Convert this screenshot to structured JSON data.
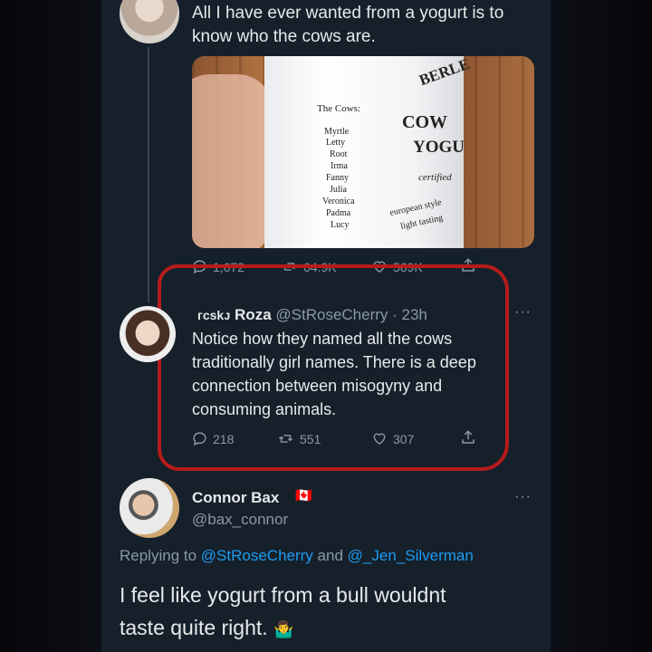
{
  "tweet1": {
    "text_line1": "All I have ever wanted from a yogurt is to",
    "text_line2": "know who the cows are.",
    "photo": {
      "brand_partial": "BERLE",
      "heading": "The Cows:",
      "names": [
        "Myrtle",
        "Letty",
        "Root",
        "Irma",
        "Fanny",
        "Julia",
        "Veronica",
        "Padma",
        "Lucy"
      ],
      "label_cow": "COW",
      "label_yog": "YOGU",
      "certified": "certified",
      "european": "european style",
      "light": "light tasting"
    },
    "replies": "1,672",
    "retweets": "64.9K",
    "likes": "569K"
  },
  "tweet2": {
    "name_prefix": "ᴦcskᴊ",
    "name": "Roza",
    "handle": "@StRoseCherry",
    "time": "23h",
    "text_lines": [
      "Notice how they named all the cows",
      "traditionally girl names. There is a deep",
      "connection between misogyny and",
      "consuming animals."
    ],
    "replies": "218",
    "retweets": "551",
    "likes": "307",
    "highlight_color": "#b61b1b"
  },
  "tweet3": {
    "name": "Connor Bax",
    "flag": "🇨🇦",
    "handle": "@bax_connor",
    "replying_prefix": "Replying to",
    "replying_user1": "@StRoseCherry",
    "replying_and": "and",
    "replying_user2": "@_Jen_Silverman",
    "text_line1": "I feel like yogurt from a bull wouldnt",
    "text_line2": "taste quite right.",
    "emoji": "🤷‍♂️"
  },
  "colors": {
    "background": "#15202b",
    "text": "#e7e9ea",
    "muted": "#8b98a5",
    "link": "#1d9bf0"
  }
}
